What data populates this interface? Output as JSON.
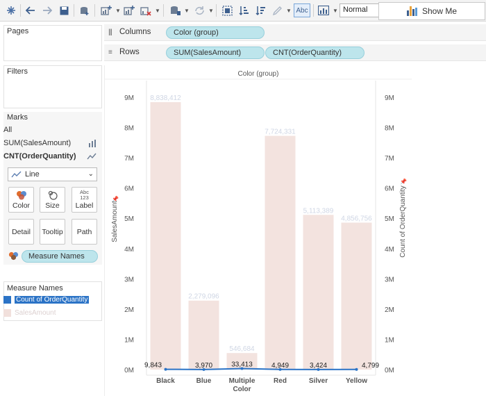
{
  "toolbar": {
    "fit_value": "Normal",
    "show_me_label": "Show Me",
    "abc_label": "Abc"
  },
  "panels": {
    "pages": "Pages",
    "filters": "Filters",
    "marks": "Marks",
    "measure_names": "Measure Names"
  },
  "marks": {
    "rows": [
      "All",
      "SUM(SalesAmount)",
      "CNT(OrderQuantity)"
    ],
    "mark_type": "Line",
    "buttons": [
      "Color",
      "Size",
      "Label",
      "Detail",
      "Tooltip",
      "Path"
    ],
    "label_icon_text": [
      "Abc",
      "123"
    ],
    "pill": "Measure Names"
  },
  "legend": {
    "items": [
      "Count of OrderQuantity",
      "SalesAmount"
    ],
    "colors": [
      "#2b73c6",
      "#f1e0dc"
    ]
  },
  "shelves": {
    "columns_label": "Columns",
    "rows_label": "Rows",
    "column_pill": "Color (group)",
    "row_pills": [
      "SUM(SalesAmount)",
      "CNT(OrderQuantity)"
    ]
  },
  "chart_data": {
    "type": "bar",
    "title": "Color (group)",
    "categories": [
      "Black",
      "Blue",
      "Multiple\nColor",
      "Red",
      "Silver",
      "Yellow"
    ],
    "series": [
      {
        "name": "SalesAmount",
        "type": "bar",
        "values": [
          8838412,
          2279096,
          546684,
          7724331,
          5113389,
          4856756
        ],
        "labels": [
          "8,838,412",
          "2,279,096",
          "546,684",
          "7,724,331",
          "5,113,389",
          "4,856,756"
        ],
        "color": "#f3e3df"
      },
      {
        "name": "Count of OrderQuantity",
        "type": "line",
        "values": [
          9843,
          3970,
          33413,
          4949,
          3424,
          4799
        ],
        "labels": [
          "9,843",
          "3,970",
          "33,413",
          "4,949",
          "3,424",
          "4,799"
        ],
        "color": "#2b73c6"
      }
    ],
    "ylabel": "SalesAmount",
    "ylabel_right": "Count of OrderQuantity",
    "ylim": [
      0,
      9000000
    ],
    "ylim_right": [
      0,
      9000000
    ],
    "yticks": [
      "0M",
      "1M",
      "2M",
      "3M",
      "4M",
      "5M",
      "6M",
      "7M",
      "8M",
      "9M"
    ],
    "grid": false
  }
}
